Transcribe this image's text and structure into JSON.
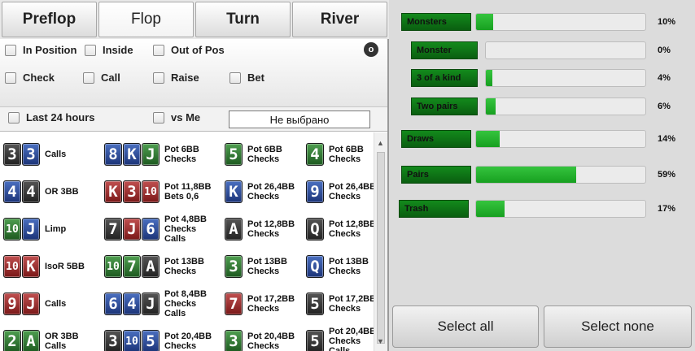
{
  "tabs": [
    "Preflop",
    "Flop",
    "Turn",
    "River"
  ],
  "filters": {
    "in_position": "In Position",
    "inside": "Inside",
    "out_of_pos": "Out of Pos",
    "check": "Check",
    "call": "Call",
    "raise": "Raise",
    "bet": "Bet",
    "clear": "o",
    "last_24": "Last 24 hours",
    "vs_me": "vs Me",
    "dropdown": "Не выбрано"
  },
  "hands": [
    {
      "cards": [
        "3",
        "3"
      ],
      "suits": [
        "s",
        "d"
      ],
      "line1": "Calls",
      "line2": "",
      "line3": ""
    },
    {
      "cards": [
        "8",
        "K",
        "J"
      ],
      "suits": [
        "d",
        "d",
        "c"
      ],
      "line1": "Pot 6BB",
      "line2": "Checks",
      "line3": ""
    },
    {
      "cards": [
        "5"
      ],
      "suits": [
        "c"
      ],
      "line1": "Pot 6BB",
      "line2": "Checks",
      "line3": ""
    },
    {
      "cards": [
        "4"
      ],
      "suits": [
        "c"
      ],
      "line1": "Pot 6BB",
      "line2": "Checks",
      "line3": ""
    },
    {
      "cards": [
        "4",
        "4"
      ],
      "suits": [
        "d",
        "s"
      ],
      "line1": "OR 3BB",
      "line2": "",
      "line3": ""
    },
    {
      "cards": [
        "K",
        "3",
        "10"
      ],
      "suits": [
        "h",
        "h",
        "h"
      ],
      "line1": "Pot 11,8BB",
      "line2": "Bets 0,6",
      "line3": ""
    },
    {
      "cards": [
        "K"
      ],
      "suits": [
        "d"
      ],
      "line1": "Pot 26,4BB",
      "line2": "Checks",
      "line3": ""
    },
    {
      "cards": [
        "9"
      ],
      "suits": [
        "d"
      ],
      "line1": "Pot 26,4BB",
      "line2": "Checks",
      "line3": ""
    },
    {
      "cards": [
        "10",
        "J"
      ],
      "suits": [
        "c",
        "d"
      ],
      "line1": "Limp",
      "line2": "",
      "line3": ""
    },
    {
      "cards": [
        "7",
        "J",
        "6"
      ],
      "suits": [
        "s",
        "h",
        "d"
      ],
      "line1": "Pot 4,8BB",
      "line2": "Checks",
      "line3": "Calls"
    },
    {
      "cards": [
        "A"
      ],
      "suits": [
        "s"
      ],
      "line1": "Pot 12,8BB",
      "line2": "Checks",
      "line3": ""
    },
    {
      "cards": [
        "Q"
      ],
      "suits": [
        "s"
      ],
      "line1": "Pot 12,8BB",
      "line2": "Checks",
      "line3": ""
    },
    {
      "cards": [
        "10",
        "K"
      ],
      "suits": [
        "h",
        "h"
      ],
      "line1": "IsoR 5BB",
      "line2": "",
      "line3": ""
    },
    {
      "cards": [
        "10",
        "7",
        "A"
      ],
      "suits": [
        "c",
        "c",
        "s"
      ],
      "line1": "Pot 13BB",
      "line2": "Checks",
      "line3": ""
    },
    {
      "cards": [
        "3"
      ],
      "suits": [
        "c"
      ],
      "line1": "Pot 13BB",
      "line2": "Checks",
      "line3": ""
    },
    {
      "cards": [
        "Q"
      ],
      "suits": [
        "d"
      ],
      "line1": "Pot 13BB",
      "line2": "Checks",
      "line3": ""
    },
    {
      "cards": [
        "9",
        "J"
      ],
      "suits": [
        "h",
        "h"
      ],
      "line1": "Calls",
      "line2": "",
      "line3": ""
    },
    {
      "cards": [
        "6",
        "4",
        "J"
      ],
      "suits": [
        "d",
        "d",
        "s"
      ],
      "line1": "Pot 8,4BB",
      "line2": "Checks",
      "line3": "Calls"
    },
    {
      "cards": [
        "7"
      ],
      "suits": [
        "h"
      ],
      "line1": "Pot 17,2BB",
      "line2": "Checks",
      "line3": ""
    },
    {
      "cards": [
        "5"
      ],
      "suits": [
        "s"
      ],
      "line1": "Pot 17,2BB",
      "line2": "Checks",
      "line3": ""
    },
    {
      "cards": [
        "2",
        "A"
      ],
      "suits": [
        "c",
        "c"
      ],
      "line1": "OR 3BB",
      "line2": "Calls",
      "line3": ""
    },
    {
      "cards": [
        "3",
        "10",
        "5"
      ],
      "suits": [
        "s",
        "d",
        "d"
      ],
      "line1": "Pot 20,4BB",
      "line2": "Checks",
      "line3": ""
    },
    {
      "cards": [
        "3"
      ],
      "suits": [
        "c"
      ],
      "line1": "Pot 20,4BB",
      "line2": "Checks",
      "line3": ""
    },
    {
      "cards": [
        "5"
      ],
      "suits": [
        "s"
      ],
      "line1": "Pot 20,4BB",
      "line2": "Checks",
      "line3": "Calls"
    }
  ],
  "categories": [
    {
      "label": "Monsters",
      "pct": "10%",
      "value": 10,
      "indent": 0
    },
    {
      "label": "Monster",
      "pct": "0%",
      "value": 0,
      "indent": 1
    },
    {
      "label": "3 of a kind",
      "pct": "4%",
      "value": 4,
      "indent": 1
    },
    {
      "label": "Two pairs",
      "pct": "6%",
      "value": 6,
      "indent": 1
    },
    {
      "label": "Draws",
      "pct": "14%",
      "value": 14,
      "indent": 0
    },
    {
      "label": "Pairs",
      "pct": "59%",
      "value": 59,
      "indent": 0
    },
    {
      "label": "Trash",
      "pct": "17%",
      "value": 17,
      "indent": 0
    }
  ],
  "buttons": {
    "select_all": "Select all",
    "select_none": "Select none"
  },
  "colors": {
    "bar_fill": "#1fb52a",
    "label_bg": "#0f7a16",
    "spade": "#333333",
    "heart": "#9c2a2a",
    "diamond": "#2a4a9a",
    "club": "#2f7a30"
  }
}
